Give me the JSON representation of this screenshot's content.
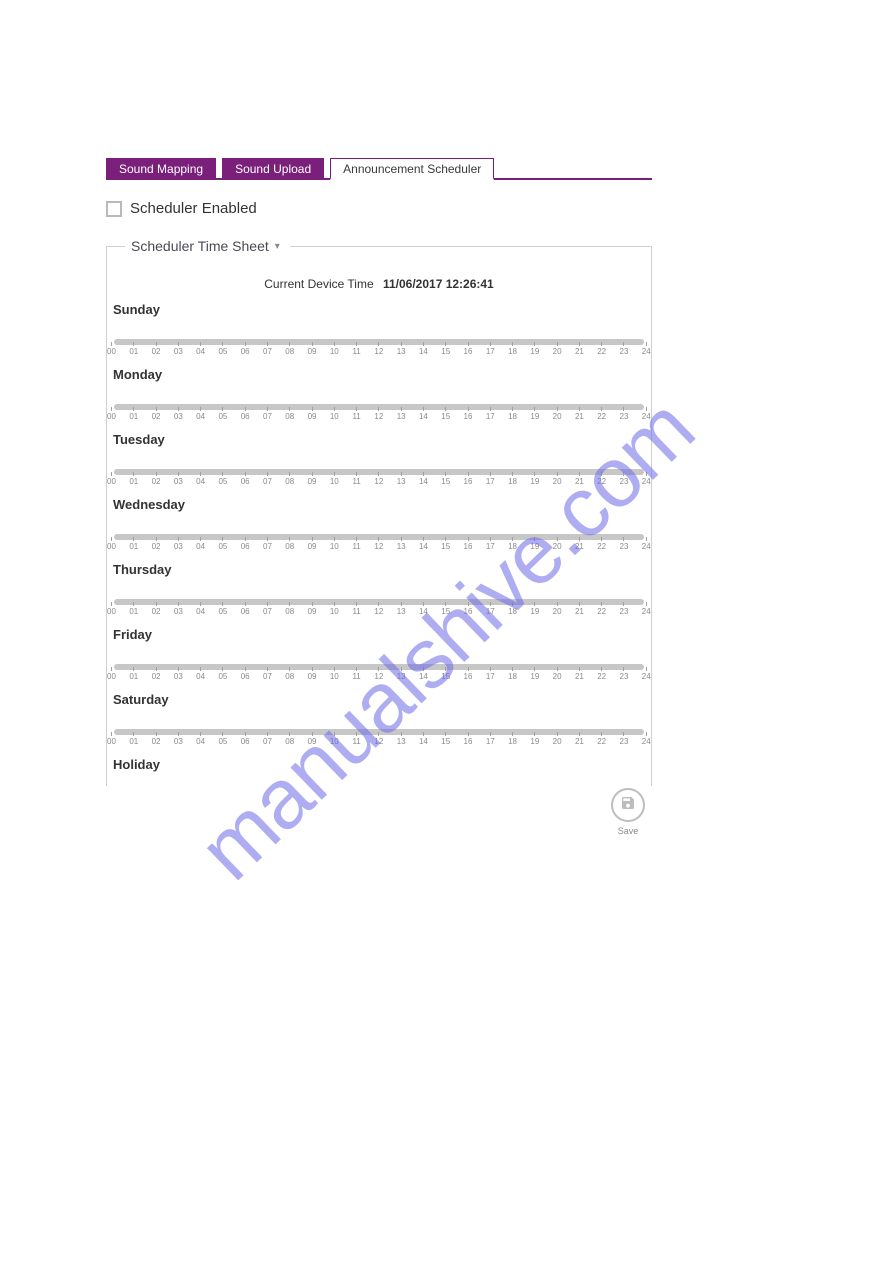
{
  "watermark": "manualshive.com",
  "tabs": [
    {
      "label": "Sound Mapping",
      "active": false
    },
    {
      "label": "Sound Upload",
      "active": false
    },
    {
      "label": "Announcement Scheduler",
      "active": true
    }
  ],
  "scheduler_enabled": {
    "label": "Scheduler Enabled",
    "checked": false
  },
  "fieldset": {
    "legend": "Scheduler Time Sheet",
    "device_time_label": "Current Device Time",
    "device_time_value": "11/06/2017 12:26:41"
  },
  "hours": [
    "00",
    "01",
    "02",
    "03",
    "04",
    "05",
    "06",
    "07",
    "08",
    "09",
    "10",
    "11",
    "12",
    "13",
    "14",
    "15",
    "16",
    "17",
    "18",
    "19",
    "20",
    "21",
    "22",
    "23",
    "24"
  ],
  "days": [
    "Sunday",
    "Monday",
    "Tuesday",
    "Wednesday",
    "Thursday",
    "Friday",
    "Saturday",
    "Holiday"
  ],
  "save": {
    "label": "Save"
  }
}
